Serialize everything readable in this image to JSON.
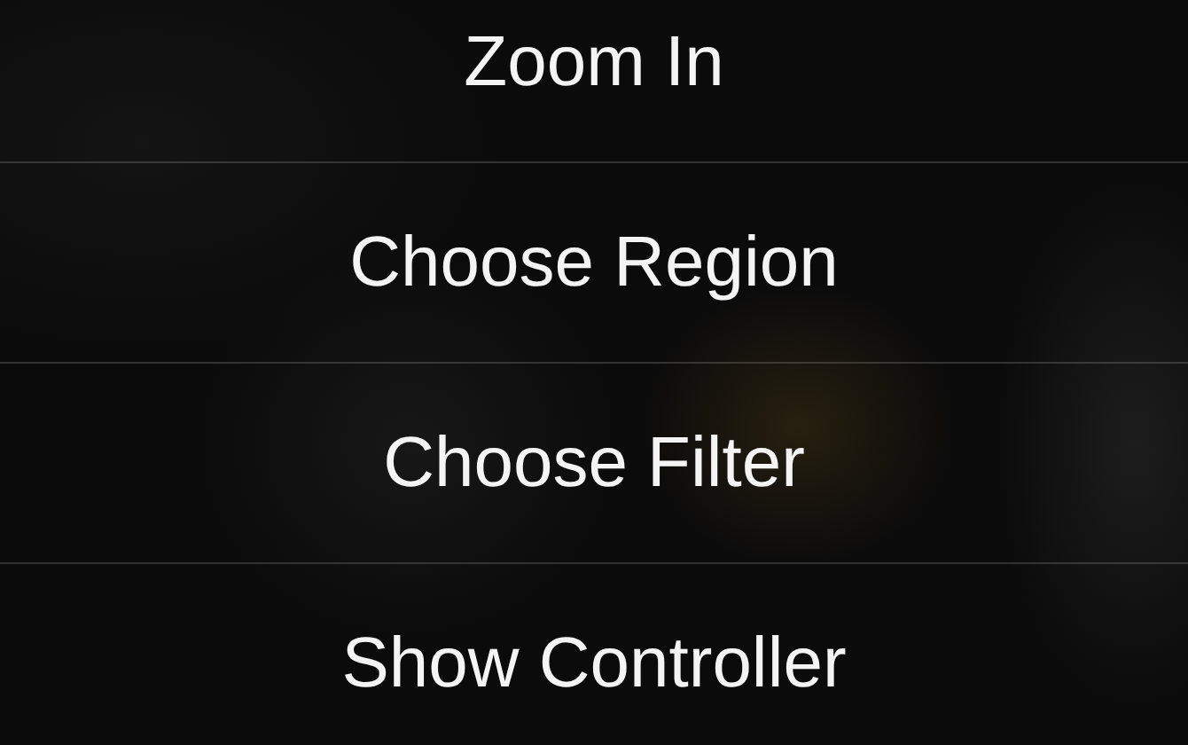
{
  "menu": {
    "items": [
      {
        "label": "Zoom In"
      },
      {
        "label": "Choose Region"
      },
      {
        "label": "Choose Filter"
      },
      {
        "label": "Show Controller"
      }
    ]
  }
}
